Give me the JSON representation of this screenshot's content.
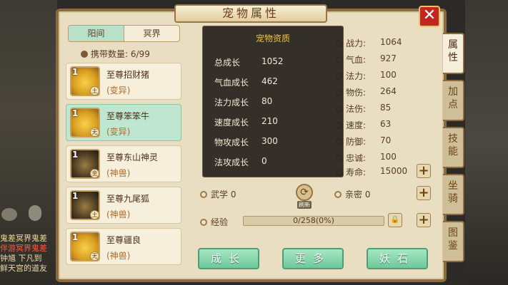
{
  "window": {
    "title": "宠物属性",
    "close_label": "✕"
  },
  "background_chat": [
    {
      "text": "鬼差冥界鬼差",
      "color": "#e8d7a8"
    },
    {
      "text": "伴游冥界鬼差",
      "color": "#ff5a3c"
    },
    {
      "text": "钟馗 下凡到",
      "color": "#e8d7a8"
    },
    {
      "text": "鲜天宫的道友",
      "color": "#e8d7a8"
    }
  ],
  "tabs": [
    {
      "label": "阳间",
      "active": true
    },
    {
      "label": "冥界",
      "active": false
    }
  ],
  "carry_count": {
    "label": "携带数量",
    "value": "6/99"
  },
  "pets": [
    {
      "level": "1",
      "name": "至尊招财猪",
      "type": "(变异)",
      "element": "土",
      "selected": false,
      "dark": false
    },
    {
      "level": "1",
      "name": "至尊笨笨牛",
      "type": "(变异)",
      "element": "无",
      "selected": true,
      "dark": false
    },
    {
      "level": "1",
      "name": "至尊东山神灵",
      "type": "(神兽)",
      "element": "金",
      "selected": false,
      "dark": true
    },
    {
      "level": "1",
      "name": "至尊九尾狐",
      "type": "(神兽)",
      "element": "土",
      "selected": false,
      "dark": true
    },
    {
      "level": "1",
      "name": "至尊疆良",
      "type": "(神兽)",
      "element": "无",
      "selected": false,
      "dark": false
    }
  ],
  "qualities": {
    "title": "宠物资质",
    "rows": [
      {
        "label": "总成长",
        "value": "1052"
      },
      {
        "label": "气血成长",
        "value": "462"
      },
      {
        "label": "法力成长",
        "value": "80"
      },
      {
        "label": "速度成长",
        "value": "210"
      },
      {
        "label": "物攻成长",
        "value": "300"
      },
      {
        "label": "法攻成长",
        "value": "0"
      }
    ]
  },
  "stats": [
    {
      "label": "战力:",
      "value": "1064"
    },
    {
      "label": "气血:",
      "value": "927"
    },
    {
      "label": "法力:",
      "value": "100"
    },
    {
      "label": "物伤:",
      "value": "264"
    },
    {
      "label": "法伤:",
      "value": "85"
    },
    {
      "label": "速度:",
      "value": "63"
    },
    {
      "label": "防御:",
      "value": "70"
    },
    {
      "label": "忠诚:",
      "value": "100"
    },
    {
      "label": "寿命:",
      "value": "15000"
    }
  ],
  "wuxue": {
    "label": "武学",
    "value": "0"
  },
  "qinmi": {
    "label": "亲密",
    "value": "0"
  },
  "refresh_label": "刷新",
  "experience": {
    "label": "经验",
    "value": "0/258(0%)",
    "progress": 0
  },
  "buttons": {
    "grow": "成长",
    "more": "更多",
    "demon_stone": "妖石"
  },
  "side_tabs": [
    {
      "label": "属\n性",
      "active": true
    },
    {
      "label": "加\n点",
      "active": false
    },
    {
      "label": "技\n能",
      "active": false
    },
    {
      "label": "坐\n骑",
      "active": false
    },
    {
      "label": "图\n鉴",
      "active": false
    }
  ]
}
